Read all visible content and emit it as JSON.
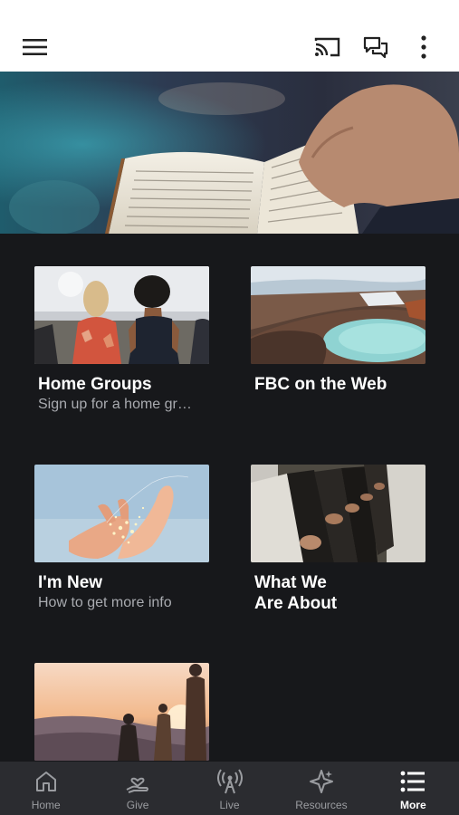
{
  "header": {
    "menu_icon": "hamburger-menu-icon",
    "cast_icon": "cast-icon",
    "chat_icon": "chat-bubbles-icon",
    "more_icon": "vertical-dots-icon"
  },
  "hero": {
    "image": "open-bible-in-hand"
  },
  "cards": [
    {
      "title": "Home Groups",
      "subtitle": "Sign up for a home gr…",
      "image": "people-standing-back-view"
    },
    {
      "title": "FBC on the Web",
      "subtitle": "",
      "image": "blue-lake-crater"
    },
    {
      "title": "I'm New",
      "subtitle": "How to get more info",
      "image": "hands-with-lights"
    },
    {
      "title": "What We\nAre About",
      "subtitle": "",
      "image": "worship-hands-folded"
    },
    {
      "title": "",
      "subtitle": "",
      "image": "people-sunset-silhouette"
    }
  ],
  "tabbar": {
    "tabs": [
      {
        "label": "Home",
        "icon": "home-icon"
      },
      {
        "label": "Give",
        "icon": "give-hand-heart-icon"
      },
      {
        "label": "Live",
        "icon": "live-broadcast-icon"
      },
      {
        "label": "Resources",
        "icon": "resources-sparkle-icon"
      },
      {
        "label": "More",
        "icon": "more-list-icon",
        "active": true
      }
    ]
  },
  "colors": {
    "background": "#17181b",
    "tabbar": "#2b2c30",
    "header": "#ffffff",
    "active_tab": "#ffffff",
    "inactive_tab": "#9a9ca0"
  }
}
